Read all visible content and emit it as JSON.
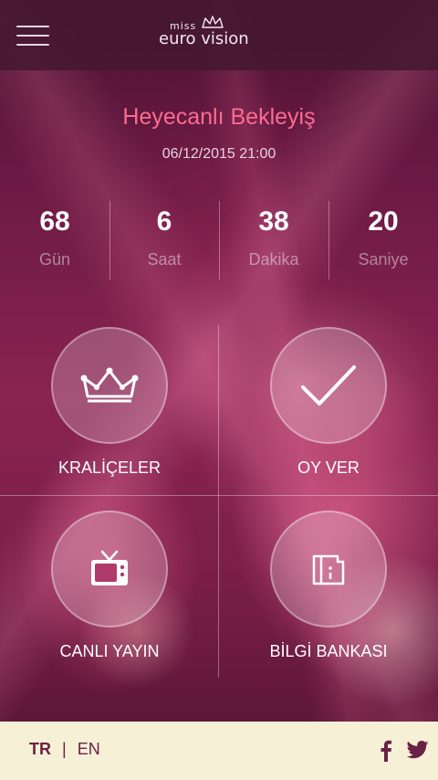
{
  "header": {
    "logo_miss": "miss",
    "logo_word": "euro vision",
    "menu_icon": "hamburger-menu-icon"
  },
  "event": {
    "title": "Heyecanlı Bekleyiş",
    "datetime": "06/12/2015 21:00"
  },
  "countdown": [
    {
      "value": "68",
      "label": "Gün"
    },
    {
      "value": "6",
      "label": "Saat"
    },
    {
      "value": "38",
      "label": "Dakika"
    },
    {
      "value": "20",
      "label": "Saniye"
    }
  ],
  "tiles": [
    {
      "label": "KRALİÇELER",
      "icon": "crown-icon"
    },
    {
      "label": "OY VER",
      "icon": "checkmark-icon"
    },
    {
      "label": "CANLI YAYIN",
      "icon": "tv-icon"
    },
    {
      "label": "BİLGİ BANKASI",
      "icon": "info-book-icon"
    }
  ],
  "footer": {
    "lang_tr": "TR",
    "lang_sep": "|",
    "lang_en": "EN",
    "social": [
      "facebook-icon",
      "twitter-icon"
    ]
  },
  "colors": {
    "title": "#ff6b8f",
    "topbar": "#461832",
    "footer": "#f6f0d6",
    "footer_text": "#6b2143"
  }
}
